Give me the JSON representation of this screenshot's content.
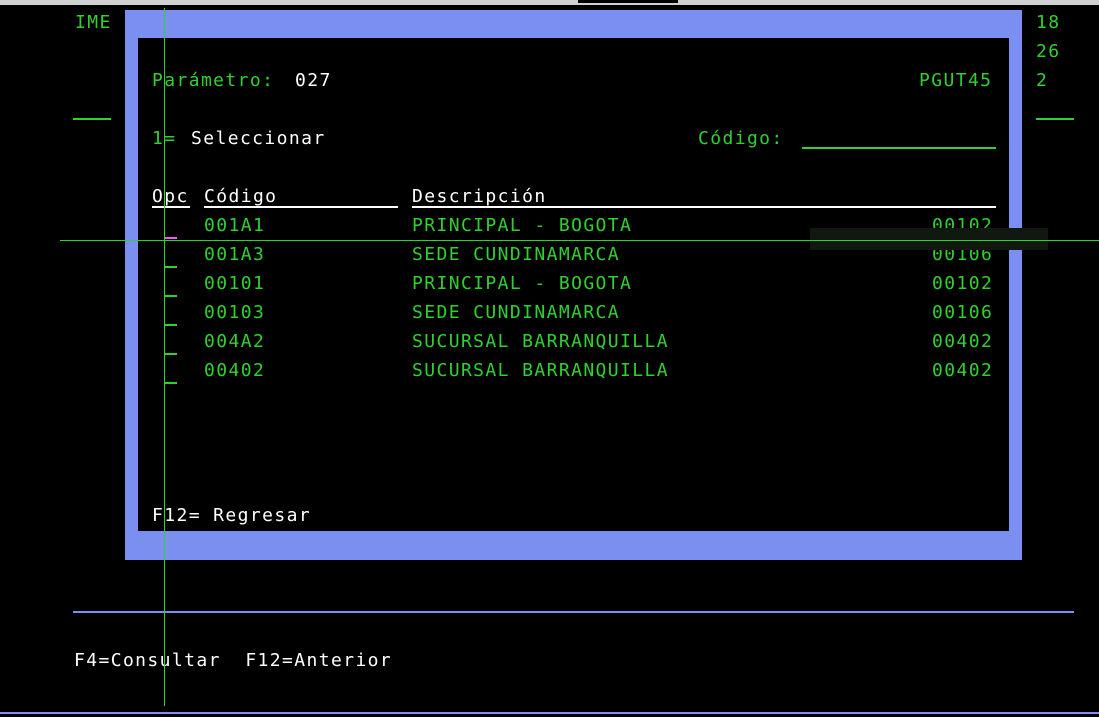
{
  "background_screen": {
    "top_left": "IME",
    "right_numbers": [
      "18",
      "26",
      "2"
    ],
    "function_keys": "F4=Consultar  F12=Anterior"
  },
  "popup": {
    "parameter_label": "Parámetro:",
    "parameter_value": "027",
    "program_id": "PGUT45",
    "option_hint_key": "1=",
    "option_hint_text": "Seleccionar",
    "code_filter_label": "Código:",
    "code_filter_value": "",
    "columns": {
      "opc": "Opc",
      "codigo": "Código",
      "descripcion": "Descripción"
    },
    "rows": [
      {
        "codigo": "001A1",
        "descripcion": "PRINCIPAL - BOGOTA",
        "valor": "00102"
      },
      {
        "codigo": "001A3",
        "descripcion": "SEDE CUNDINAMARCA",
        "valor": "00106"
      },
      {
        "codigo": "00101",
        "descripcion": "PRINCIPAL - BOGOTA",
        "valor": "00102"
      },
      {
        "codigo": "00103",
        "descripcion": "SEDE CUNDINAMARCA",
        "valor": "00106"
      },
      {
        "codigo": "004A2",
        "descripcion": "SUCURSAL BARRANQUILLA",
        "valor": "00402"
      },
      {
        "codigo": "00402",
        "descripcion": "SUCURSAL BARRANQUILLA",
        "valor": "00402"
      }
    ],
    "function_key": "F12= Regresar"
  },
  "colors": {
    "screen_bg": "#000000",
    "terminal_green": "#2fd12f",
    "window_border": "#7b8ff0",
    "text_white": "#ffffff",
    "cursor_magenta": "#ff55ff"
  }
}
